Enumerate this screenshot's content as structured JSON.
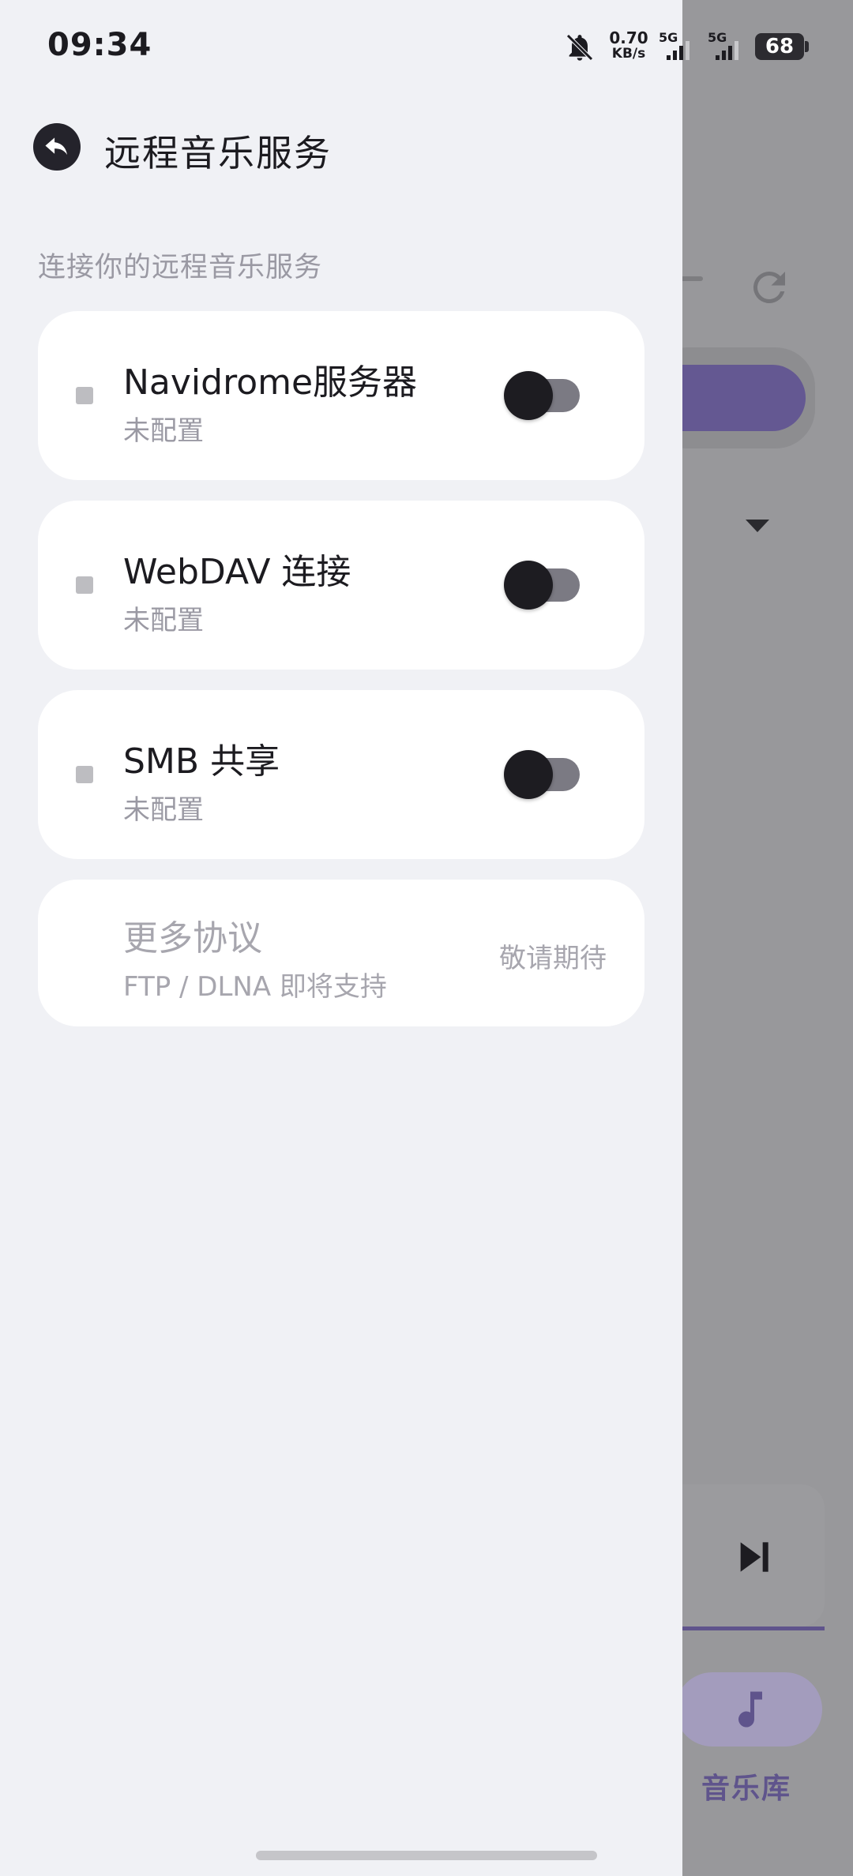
{
  "status_bar": {
    "time": "09:34",
    "net_speed_value": "0.70",
    "net_speed_unit": "KB/s",
    "network1": "5G",
    "network2": "5G",
    "battery": "68"
  },
  "header": {
    "title": "远程音乐服务"
  },
  "section_label": "连接你的远程音乐服务",
  "services": [
    {
      "title": "Navidrome服务器",
      "subtitle": "未配置",
      "enabled": false
    },
    {
      "title": "WebDAV 连接",
      "subtitle": "未配置",
      "enabled": false
    },
    {
      "title": "SMB 共享",
      "subtitle": "未配置",
      "enabled": false
    }
  ],
  "more_protocols": {
    "title": "更多协议",
    "subtitle": "FTP / DLNA 即将支持",
    "badge": "敬请期待"
  },
  "background_app": {
    "nav_label": "音乐库"
  },
  "colors": {
    "accent": "#645892",
    "drawer_bg": "#f0f1f5",
    "card_bg": "#ffffff",
    "toggle_track": "#7b7a83",
    "toggle_knob": "#1d1c21"
  }
}
